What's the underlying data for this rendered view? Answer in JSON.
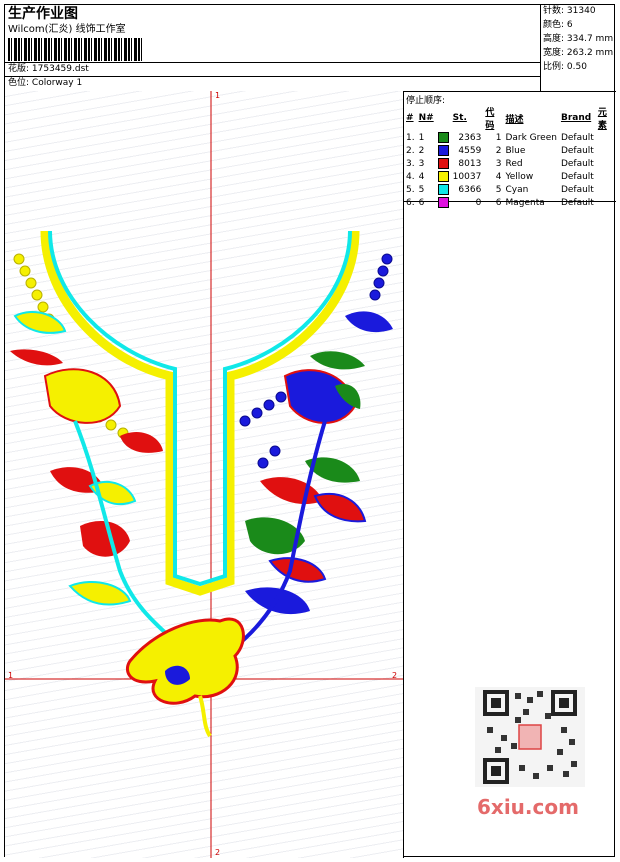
{
  "header": {
    "title": "生产作业图",
    "company": "Wilcom(汇炎) 线饰工作室",
    "design_label": "花版:",
    "design_value": "1753459.dst",
    "colorway_label": "色位:",
    "colorway_value": "Colorway 1"
  },
  "stats": [
    {
      "label": "针数:",
      "value": "31340"
    },
    {
      "label": "颜色:",
      "value": "6"
    },
    {
      "label": "高度:",
      "value": "334.7 mm"
    },
    {
      "label": "宽度:",
      "value": "263.2 mm"
    },
    {
      "label": "比例:",
      "value": "0.50"
    }
  ],
  "stop_sequence": {
    "title": "停止顺序:",
    "columns": [
      "#",
      "N#",
      "St.",
      "代码",
      "描述",
      "Brand",
      "元素"
    ],
    "rows": [
      {
        "idx": "1.",
        "n": "1",
        "color": "#1a8a1a",
        "st": "2363",
        "code": "1",
        "desc": "Dark Green",
        "brand": "Default"
      },
      {
        "idx": "2.",
        "n": "2",
        "color": "#1a1adc",
        "st": "4559",
        "code": "2",
        "desc": "Blue",
        "brand": "Default"
      },
      {
        "idx": "3.",
        "n": "3",
        "color": "#e01010",
        "st": "8013",
        "code": "3",
        "desc": "Red",
        "brand": "Default"
      },
      {
        "idx": "4.",
        "n": "4",
        "color": "#f5f000",
        "st": "10037",
        "code": "4",
        "desc": "Yellow",
        "brand": "Default"
      },
      {
        "idx": "5.",
        "n": "5",
        "color": "#10e8e8",
        "st": "6366",
        "code": "5",
        "desc": "Cyan",
        "brand": "Default"
      },
      {
        "idx": "6.",
        "n": "6",
        "color": "#e010e0",
        "st": "0",
        "code": "6",
        "desc": "Magenta",
        "brand": "Default"
      }
    ]
  },
  "axis_labels": {
    "top": "1",
    "left": "1",
    "right": "2",
    "bottom": "2"
  },
  "watermark": "6xiu.com",
  "colors": {
    "green": "#1a8a1a",
    "blue": "#1a1adc",
    "red": "#e01010",
    "yellow": "#f5f000",
    "cyan": "#10e8e8",
    "guide": "#cc0000"
  }
}
